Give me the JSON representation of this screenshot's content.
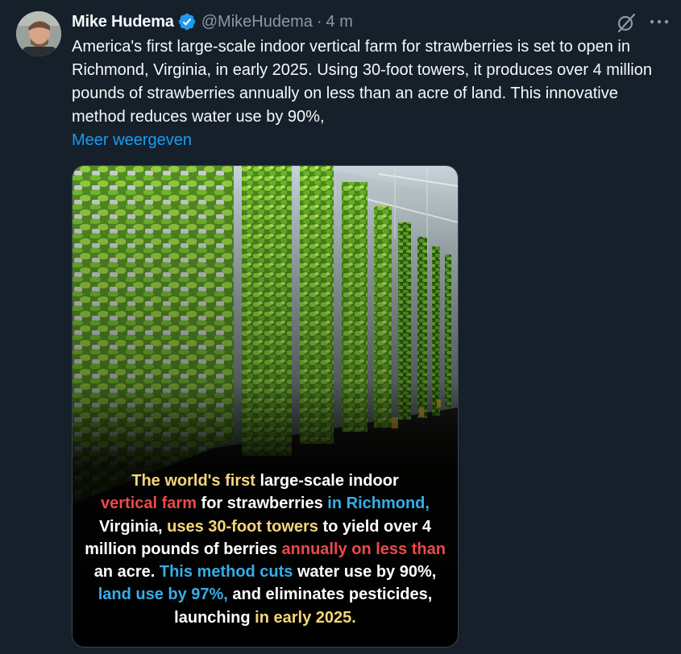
{
  "tweet": {
    "author_name": "Mike Hudema",
    "handle": "@MikeHudema",
    "separator": "·",
    "time": "4 m",
    "text": "America's first large-scale indoor vertical farm for strawberries is set to open in Richmond, Virginia, in early 2025. Using 30-foot towers, it produces over 4 million pounds of strawberries annually on less than an acre of land. This innovative method reduces water use by 90%,",
    "show_more": "Meer weergeven"
  },
  "icons": {
    "verified": "verified-badge-icon",
    "grok": "grok-icon",
    "more": "more-options-icon"
  },
  "media": {
    "caption": {
      "l1_a": "The world's first",
      "l1_b": " large-scale indoor",
      "l2_a": "vertical farm",
      "l2_b": " for strawberries ",
      "l2_c": "in Richmond,",
      "l3_a": "Virginia, ",
      "l3_b": "uses 30-foot towers",
      "l3_c": " to yield over 4",
      "l4_a": "million pounds of berries ",
      "l4_b": "annually on less than",
      "l5_a": "an acre. ",
      "l5_b": "This method cuts",
      "l5_c": " water use by 90%,",
      "l6_a": "land use by 97%,",
      "l6_b": " and eliminates pesticides,",
      "l7_a": "launching ",
      "l7_b": "in early 2025."
    }
  },
  "colors": {
    "background": "#15202b",
    "text": "#f7f9f9",
    "secondary": "#8b98a5",
    "link": "#1d9bf0",
    "verified": "#1d9bf0",
    "caption_yellow": "#f6d57a",
    "caption_red": "#ec4a4a",
    "caption_blue": "#36aee6"
  }
}
